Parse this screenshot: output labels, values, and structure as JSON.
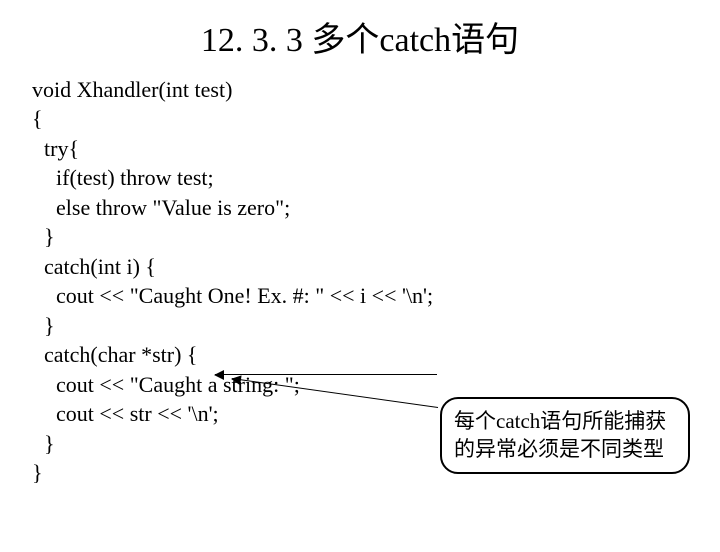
{
  "title": "12. 3. 3 多个catch语句",
  "code": {
    "line01": "void Xhandler(int test)",
    "line02": "{",
    "line03": "try{",
    "line04": "if(test) throw test;",
    "line05": "else throw \"Value is zero\";",
    "line06": "}",
    "line07": "catch(int i) {",
    "line08": "cout << \"Caught One!  Ex. #: \" << i << '\\n';",
    "line09": "}",
    "line10": "catch(char *str) {",
    "line11": "cout << \"Caught a string: \";",
    "line12": "cout << str << '\\n';",
    "line13": "}",
    "line14": "}"
  },
  "callout": {
    "line1": "每个catch语句所能捕获",
    "line2": "的异常必须是不同类型"
  }
}
